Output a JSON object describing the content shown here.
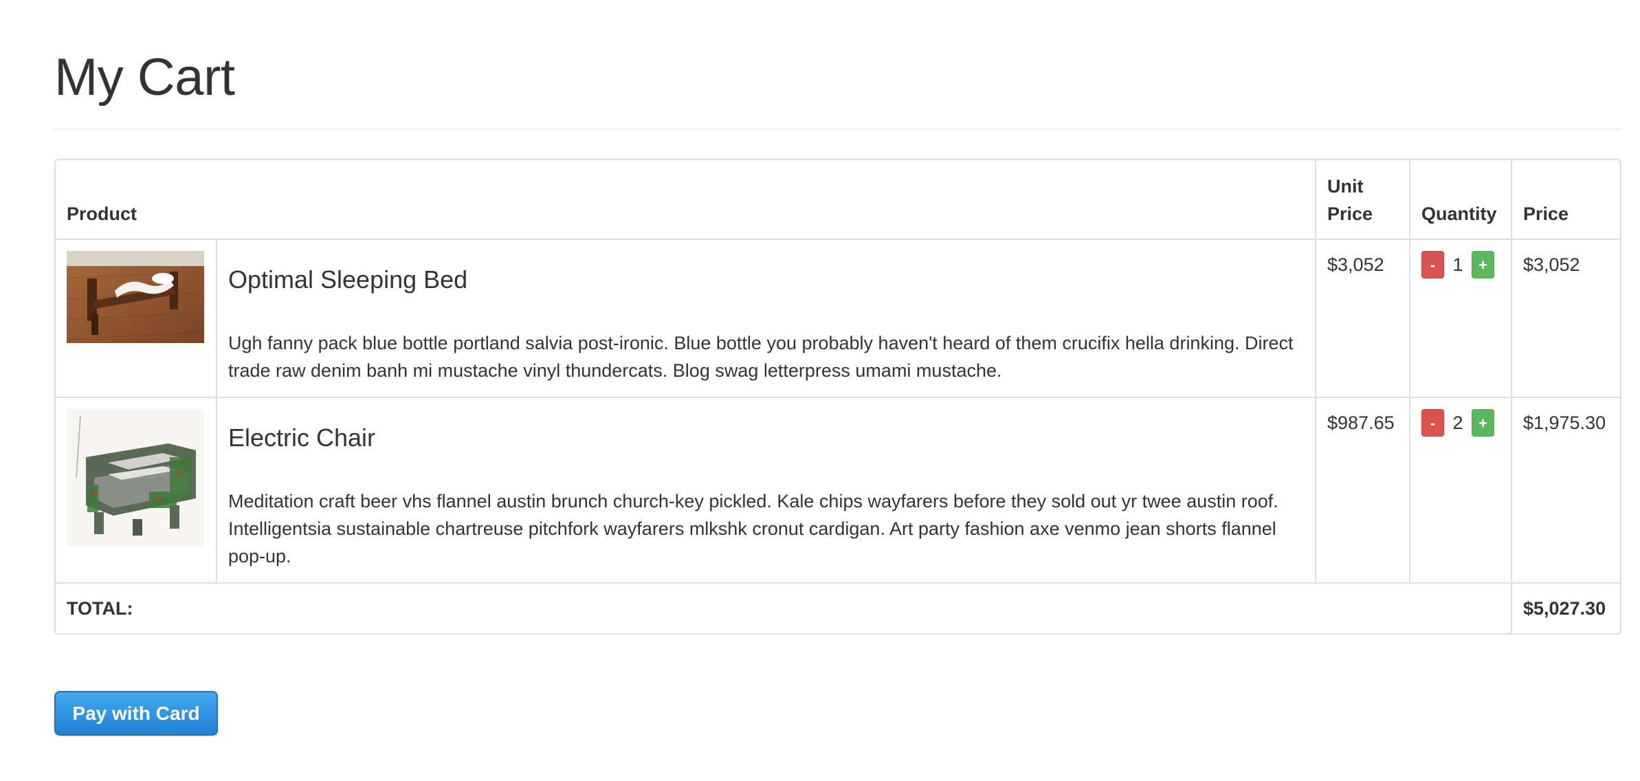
{
  "page": {
    "title": "My Cart"
  },
  "table": {
    "headers": {
      "product": "Product",
      "unit_price_line1": "Unit",
      "unit_price_line2": "Price",
      "quantity": "Quantity",
      "price": "Price"
    },
    "items": [
      {
        "name": "Optimal Sleeping Bed",
        "description": "Ugh fanny pack blue bottle portland salvia post-ironic. Blue bottle you probably haven't heard of them crucifix hella drinking. Direct trade raw denim banh mi mustache vinyl thundercats. Blog swag letterpress umami mustache.",
        "unit_price": "$3,052",
        "quantity": "1",
        "price": "$3,052",
        "minus_label": "-",
        "plus_label": "+"
      },
      {
        "name": "Electric Chair",
        "description": "Meditation craft beer vhs flannel austin brunch church-key pickled. Kale chips wayfarers before they sold out yr twee austin roof. Intelligentsia sustainable chartreuse pitchfork wayfarers mlkshk cronut cardigan. Art party fashion axe venmo jean shorts flannel pop-up.",
        "unit_price": "$987.65",
        "quantity": "2",
        "price": "$1,975.30",
        "minus_label": "-",
        "plus_label": "+"
      }
    ],
    "total_label": "TOTAL:",
    "total_value": "$5,027.30"
  },
  "actions": {
    "pay_label": "Pay with Card"
  },
  "colors": {
    "minus_button": "#d9534f",
    "plus_button": "#5cb85c",
    "pay_button": "#1e83d6"
  }
}
